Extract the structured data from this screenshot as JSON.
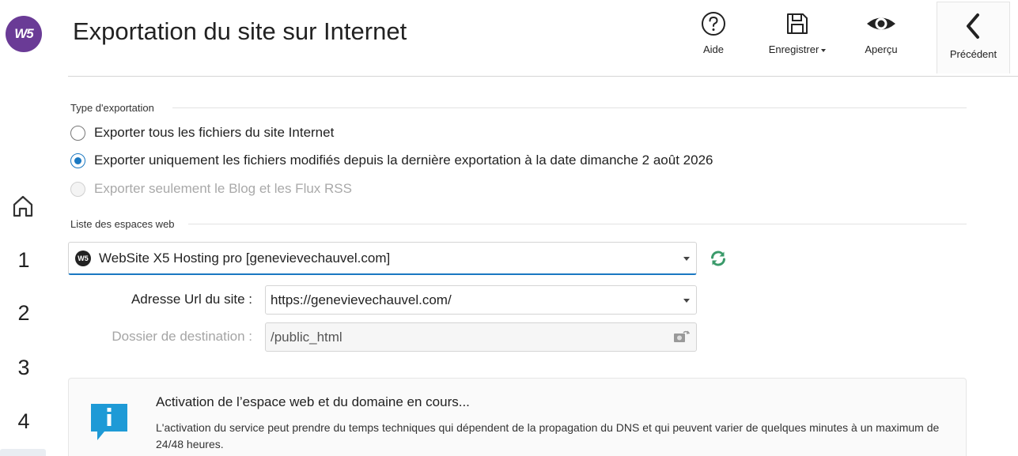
{
  "app": {
    "logo_text": "W5"
  },
  "header": {
    "title": "Exportation du site sur Internet"
  },
  "toolbar": {
    "help_label": "Aide",
    "save_label": "Enregistrer",
    "preview_label": "Aperçu",
    "back_label": "Précédent"
  },
  "steps": [
    "1",
    "2",
    "3",
    "4"
  ],
  "export_type": {
    "title": "Type d'exportation",
    "options": [
      {
        "label": "Exporter tous les fichiers du site Internet",
        "checked": false,
        "disabled": false
      },
      {
        "label": "Exporter uniquement les fichiers modifiés depuis la dernière exportation à la date dimanche 2 août 2026",
        "checked": true,
        "disabled": false
      },
      {
        "label": "Exporter seulement le Blog et les Flux RSS",
        "checked": false,
        "disabled": true
      }
    ]
  },
  "webspaces": {
    "title": "Liste des espaces web",
    "selected": "WebSite X5 Hosting pro [genevievechauvel.com]",
    "badge": "W5",
    "url_label": "Adresse Url du site :",
    "url_value": "https://genevievechauvel.com/",
    "folder_label": "Dossier de destination :",
    "folder_value": "/public_html"
  },
  "info": {
    "title": "Activation de l’espace web et du domaine en cours...",
    "text": "L'activation du service peut prendre du temps techniques qui dépendent de la propagation du DNS et qui peuvent varier de quelques minutes à un maximum de 24/48 heures."
  },
  "colors": {
    "accent": "#1a78c2",
    "logo": "#6a3b96",
    "refresh": "#3a9a6a",
    "info_icon": "#1e9ad6"
  },
  "icons": {
    "help": "question-circle-icon",
    "save": "floppy-disk-icon",
    "preview": "eye-icon",
    "back": "chevron-left-icon",
    "home": "home-icon",
    "refresh": "refresh-icon",
    "browse": "folder-browse-icon",
    "info": "info-speech-icon"
  }
}
